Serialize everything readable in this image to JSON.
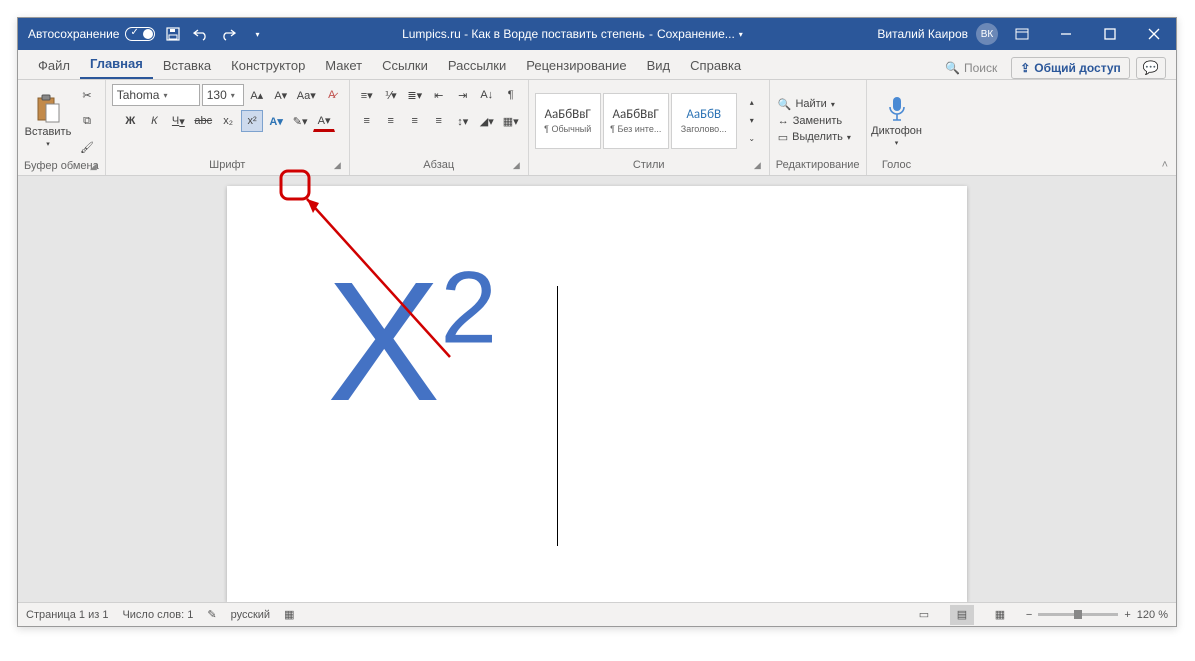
{
  "titlebar": {
    "autosave": "Автосохранение",
    "doc_title": "Lumpics.ru - Как в Ворде поставить степень",
    "saving": "Сохранение...",
    "user": "Виталий Каиров",
    "user_initials": "ВК"
  },
  "tabs": {
    "file": "Файл",
    "home": "Главная",
    "insert": "Вставка",
    "design": "Конструктор",
    "layout": "Макет",
    "references": "Ссылки",
    "mailings": "Рассылки",
    "review": "Рецензирование",
    "view": "Вид",
    "help": "Справка",
    "search": "Поиск",
    "share": "Общий доступ"
  },
  "ribbon": {
    "clipboard": {
      "paste": "Вставить",
      "label": "Буфер обмена"
    },
    "font": {
      "name": "Tahoma",
      "size": "130",
      "label": "Шрифт",
      "bold": "Ж",
      "italic": "К",
      "underline": "Ч",
      "strike": "abc",
      "sub": "x₂",
      "sup": "x²"
    },
    "paragraph": {
      "label": "Абзац"
    },
    "styles": {
      "label": "Стили",
      "items": [
        {
          "preview": "АаБбВвГ",
          "name": "¶ Обычный"
        },
        {
          "preview": "АаБбВвГ",
          "name": "¶ Без инте..."
        },
        {
          "preview": "АаБбВ",
          "name": "Заголово..."
        }
      ]
    },
    "editing": {
      "label": "Редактирование",
      "find": "Найти",
      "replace": "Заменить",
      "select": "Выделить"
    },
    "voice": {
      "dictate": "Диктофон",
      "label": "Голос"
    }
  },
  "document": {
    "text": "X",
    "exponent": "2"
  },
  "statusbar": {
    "page": "Страница 1 из 1",
    "words": "Число слов: 1",
    "lang": "русский",
    "zoom": "120 %"
  }
}
